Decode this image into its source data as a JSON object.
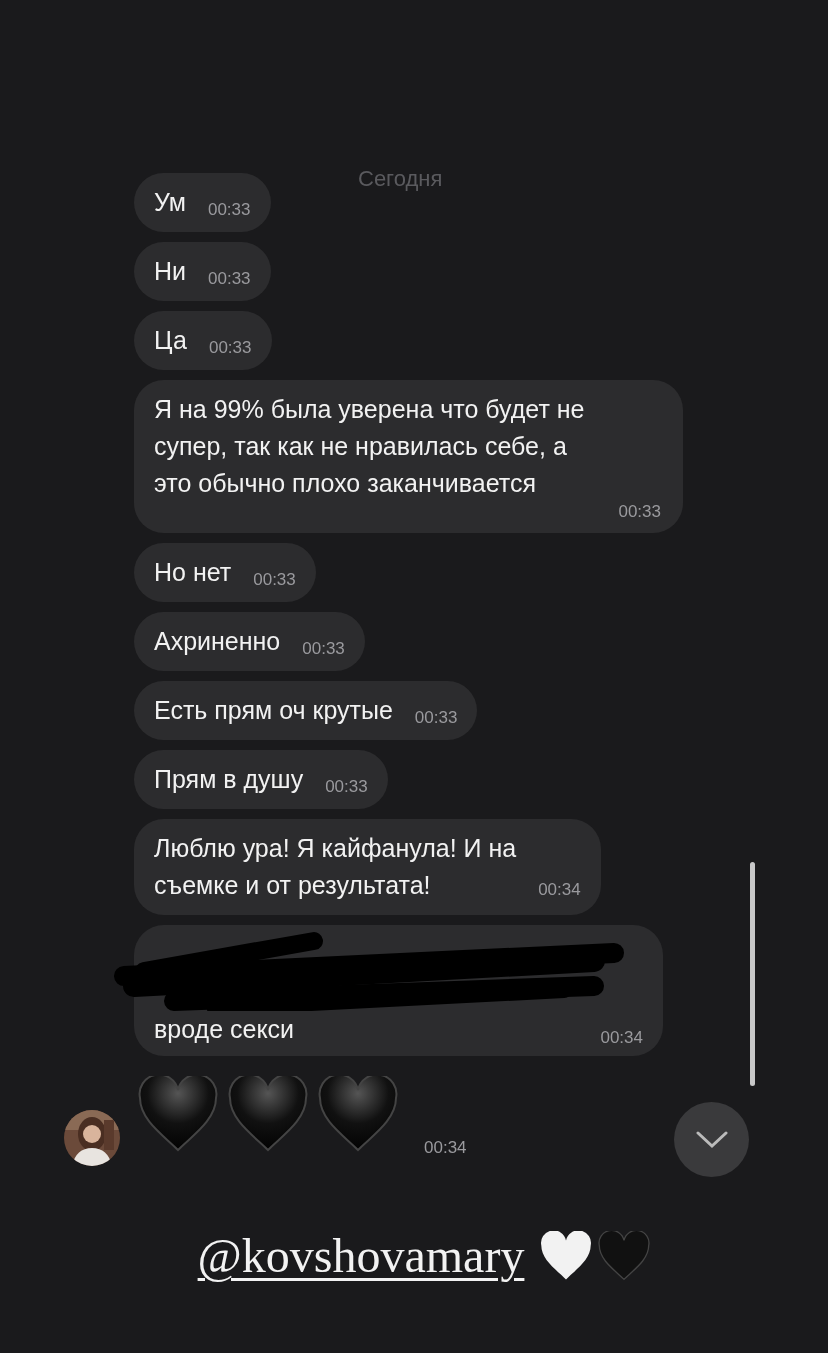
{
  "date_label": "Сегодня",
  "messages": [
    {
      "kind": "short",
      "text": "Ум",
      "time": "00:33"
    },
    {
      "kind": "short",
      "text": "Ни",
      "time": "00:33"
    },
    {
      "kind": "short",
      "text": "Ца",
      "time": "00:33"
    },
    {
      "kind": "long",
      "text": "Я на 99% была уверена что будет не\nсупер, так как не нравилась себе, а\nэто обычно плохо заканчивается",
      "time": "00:33"
    },
    {
      "kind": "short",
      "text": "Но нет",
      "time": "00:33"
    },
    {
      "kind": "short",
      "text": "Ахриненно",
      "time": "00:33"
    },
    {
      "kind": "short",
      "text": "Есть прям оч крутые",
      "time": "00:33"
    },
    {
      "kind": "short",
      "text": "Прям в душу",
      "time": "00:33"
    },
    {
      "kind": "multi",
      "text": "Люблю ура! Я кайфанула! И на\nсъемке и от результата!",
      "time": "00:34"
    },
    {
      "kind": "redacted",
      "text": "вроде секси",
      "time": "00:34"
    }
  ],
  "reaction": {
    "time": "00:34"
  },
  "caption": {
    "mention": "@kovshovamary"
  }
}
